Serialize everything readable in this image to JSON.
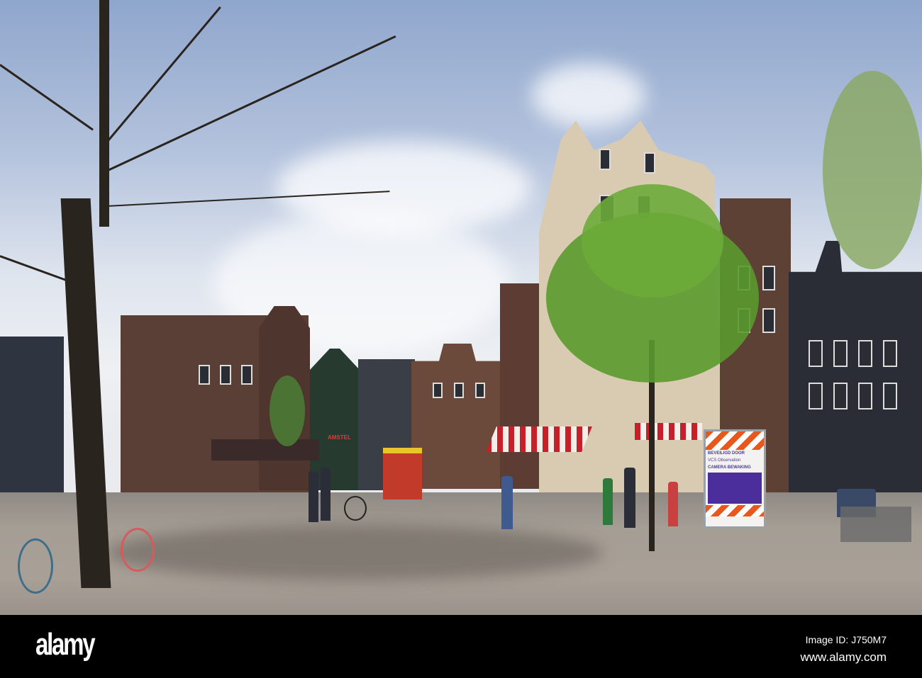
{
  "photo": {
    "subject": "Amsterdam square",
    "shop_sign": "AMSTEL",
    "camera_sign": {
      "line1": "BEVEILIGD DOOR",
      "line2": "VCS Observation",
      "line3": "CAMERA BEWAKING"
    }
  },
  "watermark": {
    "logo": "alamy",
    "image_id": "Image ID: J750M7",
    "website": "www.alamy.com"
  },
  "colors": {
    "sky": "#b4c3dd",
    "ground": "#a59e95",
    "foliage": "#5a9a2e",
    "awning_red": "#c8202a",
    "footer": "#000000"
  }
}
